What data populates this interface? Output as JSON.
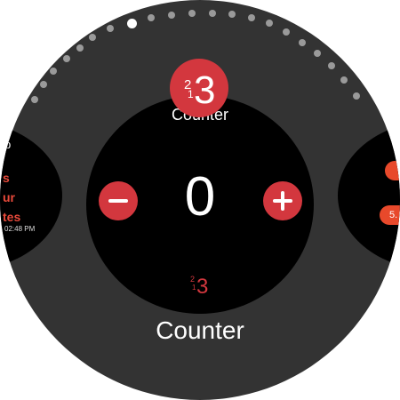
{
  "app": {
    "title": "Counter",
    "header": "Counter",
    "count_value": "0",
    "icon_name": "counter-123-icon",
    "accent_color": "#d3373e"
  },
  "controls": {
    "decrement_icon": "minus-icon",
    "increment_icon": "plus-icon"
  },
  "left_tile": {
    "label": "p",
    "lines": [
      "s",
      "ur",
      "tes"
    ],
    "time": "02:48 PM"
  },
  "right_tile": {
    "pill2_text": "5."
  },
  "pager": {
    "count": 21,
    "active_index": 0
  }
}
